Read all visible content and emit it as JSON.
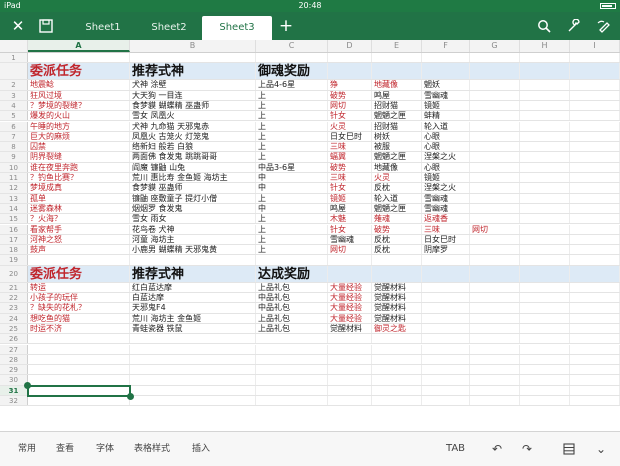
{
  "status": {
    "device": "iPad",
    "time": "20:48"
  },
  "toolbar": {
    "close_icon": "close-icon",
    "save_icon": "save-icon",
    "tabs": [
      {
        "label": "Sheet1",
        "active": false
      },
      {
        "label": "Sheet2",
        "active": false
      },
      {
        "label": "Sheet3",
        "active": true
      }
    ],
    "add_icon": "plus-icon",
    "search_icon": "search-icon",
    "settings_icon": "wrench-icon",
    "draw_icon": "draw-icon"
  },
  "columns": [
    "A",
    "B",
    "C",
    "D",
    "E",
    "F",
    "G",
    "H",
    "I"
  ],
  "selected_column": "A",
  "rows": [
    {
      "n": "1",
      "type": "blank",
      "cells": [
        "",
        "",
        "",
        "",
        "",
        "",
        "",
        "",
        ""
      ]
    },
    {
      "n": "",
      "type": "header",
      "cells": [
        "委派任务",
        "推荐式神",
        "御魂奖励",
        "",
        "",
        "",
        "",
        "",
        ""
      ],
      "red": [
        0
      ]
    },
    {
      "n": "2",
      "type": "data",
      "cells": [
        "地震鲶",
        "犬神 涂壁",
        "上品4-6星",
        "狰",
        "地藏像",
        "魍妖",
        "",
        "",
        ""
      ],
      "red": [
        0,
        3,
        4
      ]
    },
    {
      "n": "3",
      "type": "data",
      "cells": [
        "狂风过境",
        "大天狗 一目连",
        "上",
        "破势",
        "鸣屋",
        "雪幽魂",
        "",
        "",
        ""
      ],
      "red": [
        0,
        3
      ]
    },
    {
      "n": "4",
      "type": "data",
      "cells": [
        "？梦境的裂缝？",
        "食梦貘 蝴蝶精 巫蛊师",
        "上",
        "网切",
        "招财猫",
        "镜姬",
        "",
        "",
        ""
      ],
      "red": [
        0,
        3
      ]
    },
    {
      "n": "5",
      "type": "data",
      "cells": [
        "爆发的火山",
        "雪女 凤凰火",
        "上",
        "针女",
        "魍魉之匣",
        "蚌精",
        "",
        "",
        ""
      ],
      "red": [
        0,
        3
      ]
    },
    {
      "n": "6",
      "type": "data",
      "cells": [
        "午睡的地方",
        "犬神 九命猫 天邪鬼赤",
        "上",
        "火灵",
        "招财猫",
        "轮入道",
        "",
        "",
        ""
      ],
      "red": [
        0,
        3
      ]
    },
    {
      "n": "7",
      "type": "data",
      "cells": [
        "巨大的麻烦",
        "凤凰火 古笼火 灯笼鬼",
        "上",
        "日女巳时",
        "树妖",
        "心眼",
        "",
        "",
        ""
      ],
      "red": [
        0
      ]
    },
    {
      "n": "8",
      "type": "data",
      "cells": [
        "囚禁",
        "络新妇 般若 白狼",
        "上",
        "三味",
        "被服",
        "心眼",
        "",
        "",
        ""
      ],
      "red": [
        0,
        3
      ]
    },
    {
      "n": "9",
      "type": "data",
      "cells": [
        "阴界裂缝",
        "两面佛 食发鬼 跳跳哥哥",
        "上",
        "蝠翼",
        "魍魉之匣",
        "涅槃之火",
        "",
        "",
        ""
      ],
      "red": [
        0,
        3
      ]
    },
    {
      "n": "10",
      "type": "data",
      "cells": [
        "谁在夜里奔跑",
        "阎魔 镰鼬 山兔",
        "中品3-6星",
        "破势",
        "地藏像",
        "心眼",
        "",
        "",
        ""
      ],
      "red": [
        0,
        3
      ]
    },
    {
      "n": "11",
      "type": "data",
      "cells": [
        "？钓鱼比赛？",
        "荒川 惠比寿 金鱼姬 海坊主",
        "中",
        "三味",
        "火灵",
        "镜姬",
        "",
        "",
        ""
      ],
      "red": [
        0,
        3,
        4
      ]
    },
    {
      "n": "12",
      "type": "data",
      "cells": [
        "梦境成真",
        "食梦貘 巫蛊师",
        "中",
        "针女",
        "反枕",
        "涅槃之火",
        "",
        "",
        ""
      ],
      "red": [
        0,
        3
      ]
    },
    {
      "n": "13",
      "type": "data",
      "cells": [
        "孤单",
        "镰鼬 座敷童子 提灯小僧",
        "上",
        "镜姬",
        "轮入道",
        "雪幽魂",
        "",
        "",
        ""
      ],
      "red": [
        0,
        3
      ]
    },
    {
      "n": "14",
      "type": "data",
      "cells": [
        "迷雾森林",
        "烟烟罗 食发鬼",
        "中",
        "鸣屋",
        "魍魉之匣",
        "雪幽魂",
        "",
        "",
        ""
      ],
      "red": [
        0
      ]
    },
    {
      "n": "15",
      "type": "data",
      "cells": [
        "？火海？",
        "雪女 雨女",
        "上",
        "木魅",
        "薙魂",
        "返魂香",
        "",
        "",
        ""
      ],
      "red": [
        0,
        3,
        4,
        5
      ]
    },
    {
      "n": "16",
      "type": "data",
      "cells": [
        "看家帮手",
        "花鸟卷 犬神",
        "上",
        "针女",
        "破势",
        "三味",
        "网切",
        "",
        ""
      ],
      "red": [
        0,
        3,
        4,
        5,
        6
      ]
    },
    {
      "n": "17",
      "type": "data",
      "cells": [
        "河神之怒",
        "河童 海坊主",
        "上",
        "雪幽魂",
        "反枕",
        "日女巳时",
        "",
        "",
        ""
      ],
      "red": [
        0
      ]
    },
    {
      "n": "18",
      "type": "data",
      "cells": [
        "鼓声",
        "小鹿男 蝴蝶精 天邪鬼黄",
        "上",
        "网切",
        "反枕",
        "阴摩罗",
        "",
        "",
        ""
      ],
      "red": [
        0,
        3
      ]
    },
    {
      "n": "19",
      "type": "blank",
      "cells": [
        "",
        "",
        "",
        "",
        "",
        "",
        "",
        "",
        ""
      ]
    },
    {
      "n": "20",
      "type": "header",
      "cells": [
        "委派任务",
        "推荐式神",
        "达成奖励",
        "",
        "",
        "",
        "",
        "",
        ""
      ],
      "red": [
        0
      ]
    },
    {
      "n": "21",
      "type": "data",
      "cells": [
        "转运",
        "红白蓝达摩",
        "上品礼包",
        "大量经验",
        "觉醒材料",
        "",
        "",
        "",
        ""
      ],
      "red": [
        0,
        3
      ]
    },
    {
      "n": "22",
      "type": "data",
      "cells": [
        "小孩子的玩伴",
        "白蓝达摩",
        "中品礼包",
        "大量经验",
        "觉醒材料",
        "",
        "",
        "",
        ""
      ],
      "red": [
        0,
        3
      ]
    },
    {
      "n": "23",
      "type": "data",
      "cells": [
        "？缺失的花札？",
        "天邪鬼F4",
        "中品礼包",
        "大量经验",
        "觉醒材料",
        "",
        "",
        "",
        ""
      ],
      "red": [
        0,
        3
      ]
    },
    {
      "n": "24",
      "type": "data",
      "cells": [
        "想吃鱼的猫",
        "荒川 海坊主 金鱼姬",
        "上品礼包",
        "大量经验",
        "觉醒材料",
        "",
        "",
        "",
        ""
      ],
      "red": [
        0,
        3
      ]
    },
    {
      "n": "25",
      "type": "data",
      "cells": [
        "时运不济",
        "青蛙瓷器 铁鼠",
        "上品礼包",
        "觉醒材料",
        "御灵之匙",
        "",
        "",
        "",
        ""
      ],
      "red": [
        0,
        4
      ]
    },
    {
      "n": "26",
      "type": "blank",
      "cells": [
        "",
        "",
        "",
        "",
        "",
        "",
        "",
        "",
        ""
      ]
    },
    {
      "n": "27",
      "type": "blank",
      "cells": [
        "",
        "",
        "",
        "",
        "",
        "",
        "",
        "",
        ""
      ]
    },
    {
      "n": "28",
      "type": "blank",
      "cells": [
        "",
        "",
        "",
        "",
        "",
        "",
        "",
        "",
        ""
      ]
    },
    {
      "n": "29",
      "type": "blank",
      "cells": [
        "",
        "",
        "",
        "",
        "",
        "",
        "",
        "",
        ""
      ]
    },
    {
      "n": "30",
      "type": "blank",
      "cells": [
        "",
        "",
        "",
        "",
        "",
        "",
        "",
        "",
        ""
      ]
    },
    {
      "n": "31",
      "type": "blank",
      "cells": [
        "",
        "",
        "",
        "",
        "",
        "",
        "",
        "",
        ""
      ],
      "selected": true
    },
    {
      "n": "32",
      "type": "blank",
      "cells": [
        "",
        "",
        "",
        "",
        "",
        "",
        "",
        "",
        ""
      ]
    }
  ],
  "bottombar": {
    "items": [
      "常用",
      "查看",
      "字体",
      "表格样式",
      "插入"
    ],
    "tab_label": "TAB",
    "undo_icon": "undo-icon",
    "redo_icon": "redo-icon",
    "format_icon": "format-icon",
    "collapse_icon": "collapse-icon"
  }
}
